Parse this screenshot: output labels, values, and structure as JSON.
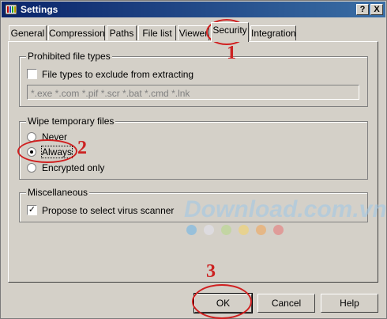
{
  "window": {
    "title": "Settings",
    "help_glyph": "?",
    "close_glyph": "X"
  },
  "tabs": [
    {
      "label": "General"
    },
    {
      "label": "Compression"
    },
    {
      "label": "Paths"
    },
    {
      "label": "File list"
    },
    {
      "label": "Viewer"
    },
    {
      "label": "Security"
    },
    {
      "label": "Integration"
    }
  ],
  "active_tab": "Security",
  "prohibited": {
    "legend": "Prohibited file types",
    "checkbox_label": "File types to exclude from extracting",
    "checked": false,
    "field_value": "*.exe *.com *.pif *.scr *.bat *.cmd *.lnk"
  },
  "wipe": {
    "legend": "Wipe temporary files",
    "options": [
      {
        "label": "Never",
        "selected": false
      },
      {
        "label": "Always",
        "selected": true
      },
      {
        "label": "Encrypted only",
        "selected": false
      }
    ]
  },
  "misc": {
    "legend": "Miscellaneous",
    "checkbox_label": "Propose to select virus scanner",
    "checked": true
  },
  "buttons": {
    "ok": "OK",
    "cancel": "Cancel",
    "help": "Help"
  },
  "annotations": {
    "n1": "1",
    "n2": "2",
    "n3": "3"
  },
  "watermark": {
    "text": "Download.com.vn",
    "dot_colors": [
      "#6fb6e6",
      "#e3e3ee",
      "#b7d98a",
      "#f3d36b",
      "#f0a65a",
      "#e67a7a"
    ]
  },
  "colors": {
    "annotation": "#cc2222",
    "titlebar": "#0a246a"
  }
}
